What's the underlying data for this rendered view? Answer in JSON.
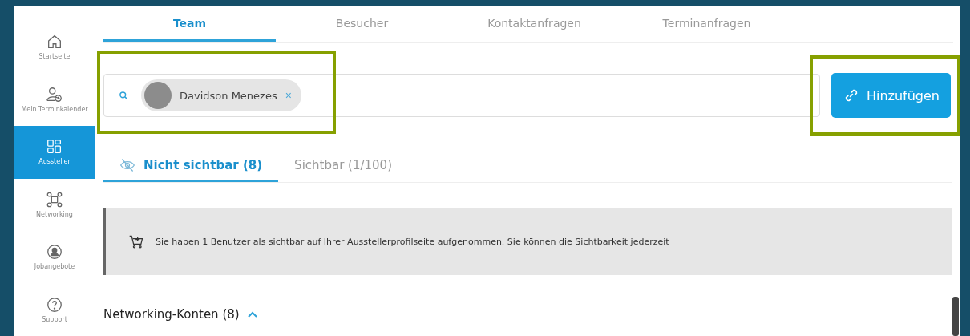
{
  "sidebar": {
    "items": [
      {
        "label": "Startseite",
        "selected": false
      },
      {
        "label": "Mein Terminkalender",
        "selected": false
      },
      {
        "label": "Aussteller",
        "selected": true
      },
      {
        "label": "Networking",
        "selected": false
      },
      {
        "label": "Jobangebote",
        "selected": false
      },
      {
        "label": "Support",
        "selected": false
      }
    ]
  },
  "tabs": [
    {
      "label": "Team",
      "selected": true
    },
    {
      "label": "Besucher",
      "selected": false
    },
    {
      "label": "Kontaktanfragen",
      "selected": false
    },
    {
      "label": "Terminanfragen",
      "selected": false
    }
  ],
  "search": {
    "chip": {
      "name": "Davidson Menezes",
      "remove": "×"
    }
  },
  "add_button": {
    "label": "Hinzufügen"
  },
  "visibility_tabs": [
    {
      "label": "Nicht sichtbar (8)",
      "selected": true
    },
    {
      "label": "Sichtbar (1/100)",
      "selected": false
    }
  ],
  "notice": {
    "text": "Sie haben 1 Benutzer als sichtbar auf Ihrer Ausstellerprofilseite aufgenommen. Sie können die Sichtbarkeit jederzeit"
  },
  "section": {
    "title": "Networking-Konten (8)",
    "expanded": true
  }
}
